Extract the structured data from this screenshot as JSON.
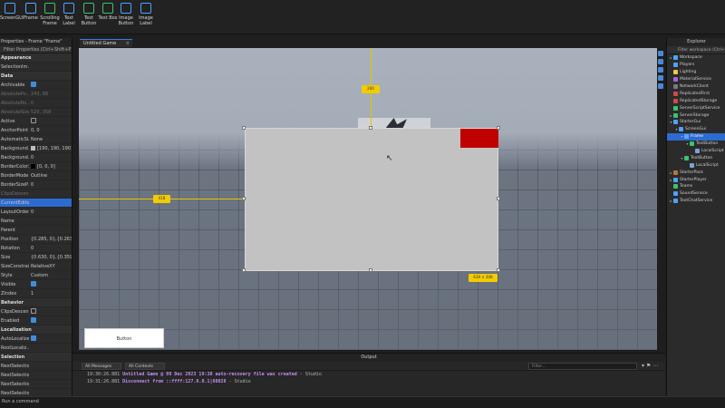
{
  "ribbon": {
    "tools": [
      {
        "label": "ScreenGUI",
        "name": "screengui-tool",
        "color": "#4da3ff"
      },
      {
        "label": "Frame",
        "name": "frame-tool",
        "color": "#5aa8ff"
      },
      {
        "label": "Scrolling Frame",
        "name": "scrolling-frame-tool",
        "color": "#3cc36e"
      },
      {
        "label": "Text Label",
        "name": "text-label-tool",
        "color": "#4da3ff"
      },
      {
        "label": "Text Button",
        "name": "text-button-tool",
        "color": "#3cc36e"
      },
      {
        "label": "Text Box",
        "name": "text-box-tool",
        "color": "#3cc36e"
      },
      {
        "label": "Image Button",
        "name": "image-button-tool",
        "color": "#4da3ff"
      },
      {
        "label": "Image Label",
        "name": "image-label-tool",
        "color": "#4da3ff"
      }
    ]
  },
  "properties": {
    "title": "Properties - Frame \"Frame\"",
    "filter_placeholder": "Filter Properties (Ctrl+Shift+P)",
    "rows": [
      {
        "type": "section",
        "name": "Appearance"
      },
      {
        "type": "prop",
        "name": "SelectionIm...",
        "value": ""
      },
      {
        "type": "section",
        "name": "Data"
      },
      {
        "type": "prop",
        "name": "Archivable",
        "check": true
      },
      {
        "type": "prop",
        "name": "AbsolutePo...",
        "value": "243, 88",
        "dim": true
      },
      {
        "type": "prop",
        "name": "AbsoluteRo...",
        "value": "0",
        "dim": true
      },
      {
        "type": "prop",
        "name": "AbsoluteSize",
        "value": "520, 358",
        "dim": true
      },
      {
        "type": "prop",
        "name": "Active",
        "check": false
      },
      {
        "type": "prop",
        "name": "AnchorPoint",
        "value": "0, 0"
      },
      {
        "type": "prop",
        "name": "AutomaticSize",
        "value": "None"
      },
      {
        "type": "prop",
        "name": "Background...",
        "value": "[190, 190, 190]",
        "swatch": "#bebebe"
      },
      {
        "type": "prop",
        "name": "Background...",
        "value": "0"
      },
      {
        "type": "prop",
        "name": "BorderColor3",
        "value": "[0, 0, 0]",
        "swatch": "#000000"
      },
      {
        "type": "prop",
        "name": "BorderMode",
        "value": "Outline"
      },
      {
        "type": "prop",
        "name": "BorderSizeP...",
        "value": "0"
      },
      {
        "type": "prop",
        "name": "ClipsDescen...",
        "value": "",
        "dim": true
      },
      {
        "type": "prop",
        "name": "CurrentEditor",
        "value": "",
        "selected": true
      },
      {
        "type": "prop",
        "name": "LayoutOrder",
        "value": "0"
      },
      {
        "type": "prop",
        "name": "Name",
        "value": ""
      },
      {
        "type": "prop",
        "name": "Parent",
        "value": ""
      },
      {
        "type": "prop",
        "name": "Position",
        "value": "{0.285, 0},{0.263, 0}"
      },
      {
        "type": "prop",
        "name": "Rotation",
        "value": "0"
      },
      {
        "type": "prop",
        "name": "Size",
        "value": "{0.630, 0},{0.359}"
      },
      {
        "type": "prop",
        "name": "SizeConstraint",
        "value": "RelativeXY"
      },
      {
        "type": "prop",
        "name": "Style",
        "value": "Custom"
      },
      {
        "type": "prop",
        "name": "Visible",
        "check": true
      },
      {
        "type": "prop",
        "name": "ZIndex",
        "value": "1"
      },
      {
        "type": "section",
        "name": "Behavior"
      },
      {
        "type": "prop",
        "name": "ClipsDescen...",
        "check": false
      },
      {
        "type": "prop",
        "name": "Enabled",
        "check": true
      },
      {
        "type": "section",
        "name": "Localization"
      },
      {
        "type": "prop",
        "name": "AutoLocalize",
        "check": true
      },
      {
        "type": "prop",
        "name": "RootLocaliz...",
        "value": ""
      },
      {
        "type": "section",
        "name": "Selection"
      },
      {
        "type": "prop",
        "name": "NextSelection...",
        "value": ""
      },
      {
        "type": "prop",
        "name": "NextSelection...",
        "value": ""
      },
      {
        "type": "prop",
        "name": "NextSelection...",
        "value": ""
      },
      {
        "type": "prop",
        "name": "NextSelection...",
        "value": ""
      },
      {
        "type": "prop",
        "name": "Selectable",
        "check": true
      }
    ]
  },
  "viewport": {
    "tab_label": "Untitled Game",
    "tab_close": "×",
    "guide_top_value": "200",
    "guide_left_value": "418",
    "size_value": "639 × 308",
    "button_label": "Button"
  },
  "output": {
    "title": "Output",
    "filter_messages": "All Messages",
    "filter_contexts": "All Contexts",
    "filter_placeholder": "Filter...",
    "lines": [
      {
        "time": "19:30:26.881",
        "msg": "Untitled Game @ 09 Dec 2023 19:30 auto-recovery file was created",
        "src": "- Studio"
      },
      {
        "time": "19:31:26.881",
        "msg": "Disconnect from ::ffff:127.0.0.1|60828",
        "src": "- Studio"
      }
    ]
  },
  "command_bar": {
    "placeholder": "Run a command"
  },
  "explorer": {
    "title": "Explorer",
    "filter_placeholder": "Filter workspace (Ctrl+Shift+X)",
    "items": [
      {
        "label": "Workspace",
        "depth": 0,
        "expand": "▸",
        "color": "#4da3ff"
      },
      {
        "label": "Players",
        "depth": 0,
        "expand": "",
        "color": "#4da3ff"
      },
      {
        "label": "Lighting",
        "depth": 0,
        "expand": "",
        "color": "#f2c744"
      },
      {
        "label": "MaterialService",
        "depth": 0,
        "expand": "",
        "color": "#9c6bd6"
      },
      {
        "label": "NetworkClient",
        "depth": 0,
        "expand": "",
        "color": "#7a7a7a"
      },
      {
        "label": "ReplicatedFirst",
        "depth": 0,
        "expand": "",
        "color": "#d04a4a"
      },
      {
        "label": "ReplicatedStorage",
        "depth": 0,
        "expand": "",
        "color": "#d04a4a"
      },
      {
        "label": "ServerScriptService",
        "depth": 0,
        "expand": "",
        "color": "#3cc36e"
      },
      {
        "label": "ServerStorage",
        "depth": 0,
        "expand": "▸",
        "color": "#3cc36e"
      },
      {
        "label": "StarterGui",
        "depth": 0,
        "expand": "▾",
        "color": "#4da3ff"
      },
      {
        "label": "ScreenGui",
        "depth": 1,
        "expand": "▾",
        "color": "#4da3ff"
      },
      {
        "label": "Frame",
        "depth": 2,
        "expand": "▾",
        "color": "#5aa8ff",
        "selected": true
      },
      {
        "label": "TextButton",
        "depth": 3,
        "expand": "▾",
        "color": "#3cc36e"
      },
      {
        "label": "LocalScript",
        "depth": 4,
        "expand": "",
        "color": "#7aa4d6"
      },
      {
        "label": "TextButton",
        "depth": 2,
        "expand": "▾",
        "color": "#3cc36e"
      },
      {
        "label": "LocalScript",
        "depth": 3,
        "expand": "",
        "color": "#7aa4d6"
      },
      {
        "label": "StarterPack",
        "depth": 0,
        "expand": "▸",
        "color": "#b07a3c"
      },
      {
        "label": "StarterPlayer",
        "depth": 0,
        "expand": "▸",
        "color": "#4da3ff"
      },
      {
        "label": "Teams",
        "depth": 0,
        "expand": "",
        "color": "#3cc36e"
      },
      {
        "label": "SoundService",
        "depth": 0,
        "expand": "",
        "color": "#4da3ff"
      },
      {
        "label": "TextChatService",
        "depth": 0,
        "expand": "▸",
        "color": "#4da3ff"
      }
    ]
  },
  "colors": {
    "accent": "#2e6bd0",
    "frame_fill": "#c2c2c2",
    "inner_box": "#c00000",
    "guide": "#e5c400",
    "log_message": "#c58cf0"
  }
}
